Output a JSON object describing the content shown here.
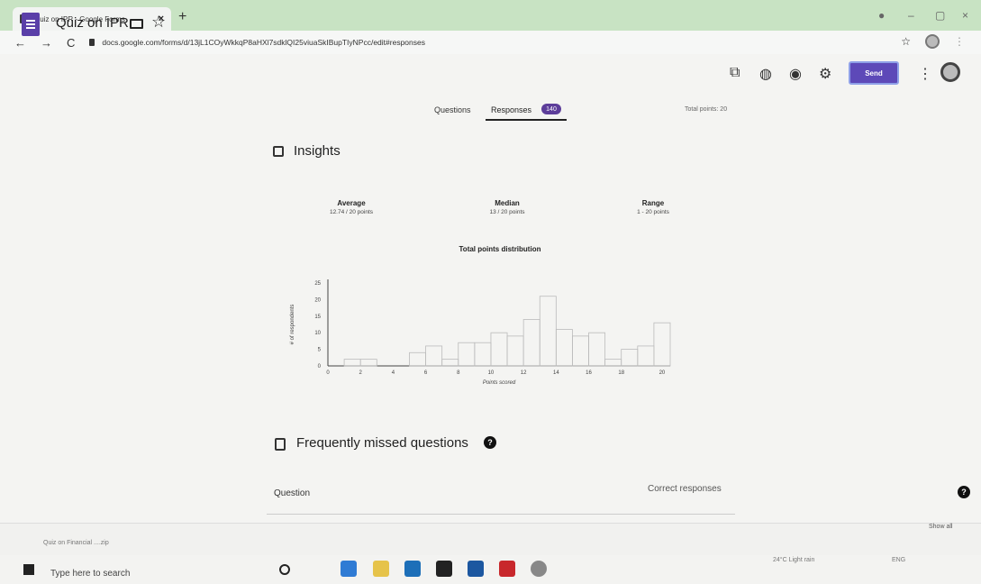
{
  "browser": {
    "tab_title": "Quiz on IPR - Google Forms",
    "url": "docs.google.com/forms/d/13jL1COyWkkqP8aHXl7sdklQI25viuaSkIBupTIyNPcc/edit#responses"
  },
  "form": {
    "title": "Quiz on IPR",
    "send_label": "Send"
  },
  "tabs": {
    "questions": "Questions",
    "responses": "Responses",
    "responses_count": "140",
    "total_points": "Total points: 20"
  },
  "insights": {
    "title": "Insights",
    "average_label": "Average",
    "average_value": "12.74 / 20 points",
    "median_label": "Median",
    "median_value": "13 / 20 points",
    "range_label": "Range",
    "range_value": "1 - 20 points"
  },
  "chart_data": {
    "type": "bar",
    "title": "Total points distribution",
    "xlabel": "Points scored",
    "ylabel": "# of respondents",
    "categories": [
      "0",
      "1",
      "2",
      "3",
      "4",
      "5",
      "6",
      "7",
      "8",
      "9",
      "10",
      "11",
      "12",
      "13",
      "14",
      "15",
      "16",
      "17",
      "18",
      "19",
      "20"
    ],
    "values": [
      0,
      2,
      2,
      0,
      0,
      4,
      6,
      2,
      7,
      7,
      10,
      9,
      14,
      21,
      11,
      9,
      10,
      2,
      5,
      6,
      13
    ],
    "x_ticks": [
      "0",
      "2",
      "4",
      "6",
      "8",
      "10",
      "12",
      "14",
      "16",
      "18",
      "20"
    ],
    "y_ticks": [
      "0",
      "5",
      "10",
      "15",
      "20",
      "25"
    ],
    "ylim": [
      0,
      25
    ],
    "grid": false
  },
  "missed": {
    "title": "Frequently missed questions",
    "col_question": "Question",
    "col_correct": "Correct responses"
  },
  "shelf": {
    "item": "Quiz on Financial ....zip",
    "show_all": "Show all"
  },
  "taskbar": {
    "search_placeholder": "Type here to search",
    "weather": "24°C Light rain",
    "lang": "ENG"
  },
  "colors": {
    "accent": "#5d49b8",
    "badge": "#5d3e9a",
    "tabstrip": "#c8e3c3"
  }
}
